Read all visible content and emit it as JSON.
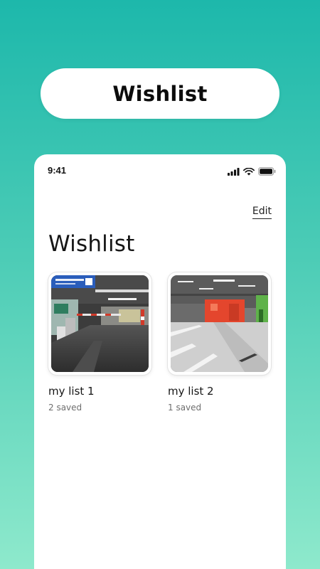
{
  "banner": {
    "title": "Wishlist"
  },
  "status_bar": {
    "time": "9:41"
  },
  "header": {
    "edit_label": "Edit",
    "title": "Wishlist"
  },
  "lists": [
    {
      "name": "my list 1",
      "saved": "2 saved",
      "image": "parking-garage-exit-photo"
    },
    {
      "name": "my list 2",
      "saved": "1 saved",
      "image": "parking-garage-interior-photo"
    }
  ],
  "colors": {
    "background_top": "#1db8ab",
    "background_bottom": "#8ee9cc",
    "card": "#ffffff",
    "text": "#161616",
    "muted_text": "#6e6e6e"
  }
}
